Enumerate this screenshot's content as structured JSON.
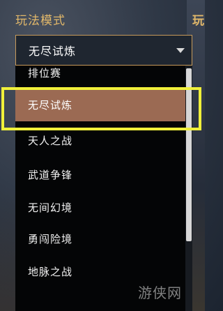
{
  "header": {
    "section_label": "玩法模式",
    "right_section_label": "玩"
  },
  "select": {
    "value": "无尽试炼",
    "icon": "chevron-down-icon"
  },
  "dropdown": {
    "options": [
      {
        "label": "排位赛"
      },
      {
        "label": "无尽试炼",
        "selected": true
      },
      {
        "label": "天人之战"
      },
      {
        "label": "武道争锋"
      },
      {
        "label": "无间幻境"
      },
      {
        "label": "勇闯险境"
      },
      {
        "label": "地脉之战"
      }
    ]
  },
  "watermark": {
    "text": "游侠网"
  },
  "colors": {
    "accent_gold": "#e2b86a",
    "selected_bg": "#9b6a53",
    "highlight_frame": "#f0f03a",
    "list_bg": "#040506"
  }
}
